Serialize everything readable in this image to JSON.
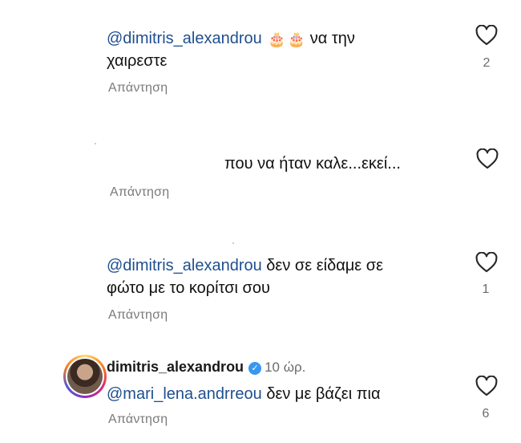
{
  "comments": [
    {
      "mention": "@dimitris_alexandrou",
      "emojis": [
        "birthday-cake",
        "birthday-cake"
      ],
      "line1_rest": "να την",
      "line2": "χαιρεστε",
      "reply_label": "Απάντηση",
      "likes": "2"
    },
    {
      "text": "που να ήταν καλε...εκεί...",
      "reply_label": "Απάντηση"
    },
    {
      "mention": "@dimitris_alexandrou",
      "line1_rest": "δεν σε είδαμε σε",
      "line2": "φώτο με το κορίτσι σου",
      "reply_label": "Απάντηση",
      "likes": "1"
    },
    {
      "username": "dimitris_alexandrou",
      "time": "10 ώρ.",
      "mention": "@mari_lena.andrreou",
      "rest": "δεν με βάζει πια",
      "reply_label": "Απάντηση",
      "likes": "6"
    }
  ],
  "colors": {
    "mention": "#1f4f8f",
    "verified": "#3897f0",
    "secondary_text": "#7a7a7a"
  },
  "icons": [
    "heart-outline-icon",
    "verified-badge-icon",
    "birthday-cake-icon"
  ]
}
